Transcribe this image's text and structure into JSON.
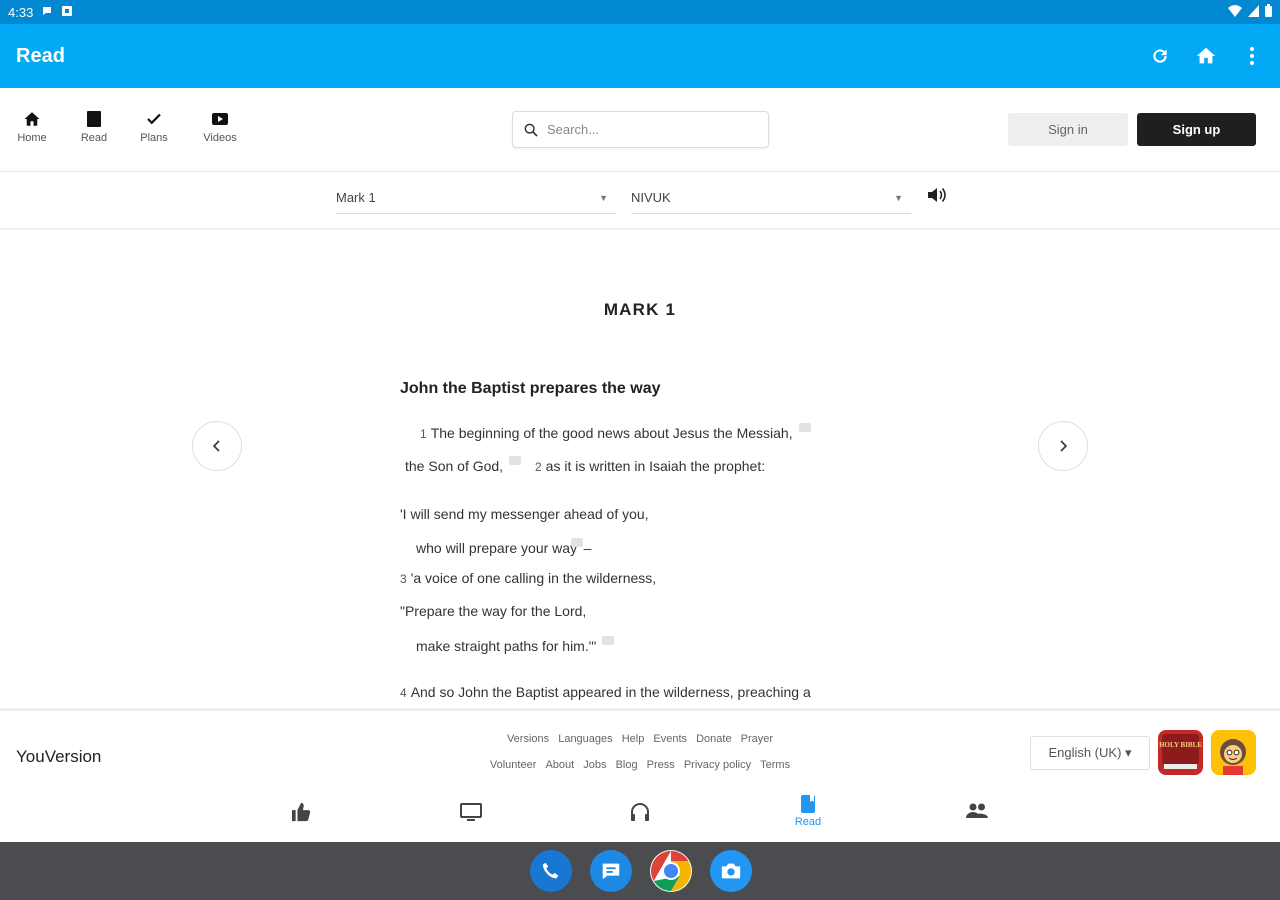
{
  "status_bar": {
    "time": "4:33"
  },
  "app_bar": {
    "title": "Read",
    "refresh_icon": "refresh-icon",
    "home_icon": "home-icon",
    "menu_icon": "more-vert-icon"
  },
  "nav": {
    "items": [
      {
        "label": "Home",
        "icon": "home-icon"
      },
      {
        "label": "Read",
        "icon": "book-icon"
      },
      {
        "label": "Plans",
        "icon": "check-icon"
      },
      {
        "label": "Videos",
        "icon": "video-icon"
      }
    ],
    "search_placeholder": "Search...",
    "signin_label": "Sign in",
    "signup_label": "Sign up"
  },
  "selectors": {
    "book": "Mark 1",
    "version": "NIVUK"
  },
  "reader": {
    "chapter_title": "MARK 1",
    "section_heading": "John the Baptist prepares the way",
    "verses": {
      "v1_num": "1",
      "v1_text": "The beginning of the good news about Jesus the Messiah,",
      "v1b_text": "the Son of God,",
      "v2_num": "2",
      "v2_text": "as it is written in Isaiah the prophet:",
      "q1": "'I will send my messenger ahead of you,",
      "q2": "who will prepare your way' –",
      "v3_num": "3",
      "q3": "'a voice of one calling in the wilderness,",
      "q4": "\"Prepare the way for the Lord,",
      "q5": "make straight paths for him.\"'",
      "v4_num": "4",
      "v4_text": "And so John the Baptist appeared in the wilderness, preaching a"
    }
  },
  "footer": {
    "brand": "YouVersion",
    "links_row1": [
      "Versions",
      "Languages",
      "Help",
      "Events",
      "Donate",
      "Prayer"
    ],
    "links_row2": [
      "Volunteer",
      "About",
      "Jobs",
      "Blog",
      "Press",
      "Privacy policy",
      "Terms"
    ],
    "language": "English (UK) ▾",
    "bible_app_badge": "HOLY BIBLE"
  },
  "bottom_tabs": {
    "items": [
      {
        "icon": "thumbs-up-icon",
        "label": ""
      },
      {
        "icon": "tv-icon",
        "label": ""
      },
      {
        "icon": "headphones-icon",
        "label": ""
      },
      {
        "icon": "book-icon",
        "label": "Read",
        "active": true
      },
      {
        "icon": "people-icon",
        "label": ""
      }
    ]
  },
  "dock": {
    "apps": [
      "phone-icon",
      "messages-icon",
      "chrome-icon",
      "camera-icon"
    ]
  },
  "colors": {
    "status_bar": "#0288d1",
    "app_bar": "#03a9f4",
    "accent": "#2196f3",
    "dock": "#4a4c4f"
  }
}
